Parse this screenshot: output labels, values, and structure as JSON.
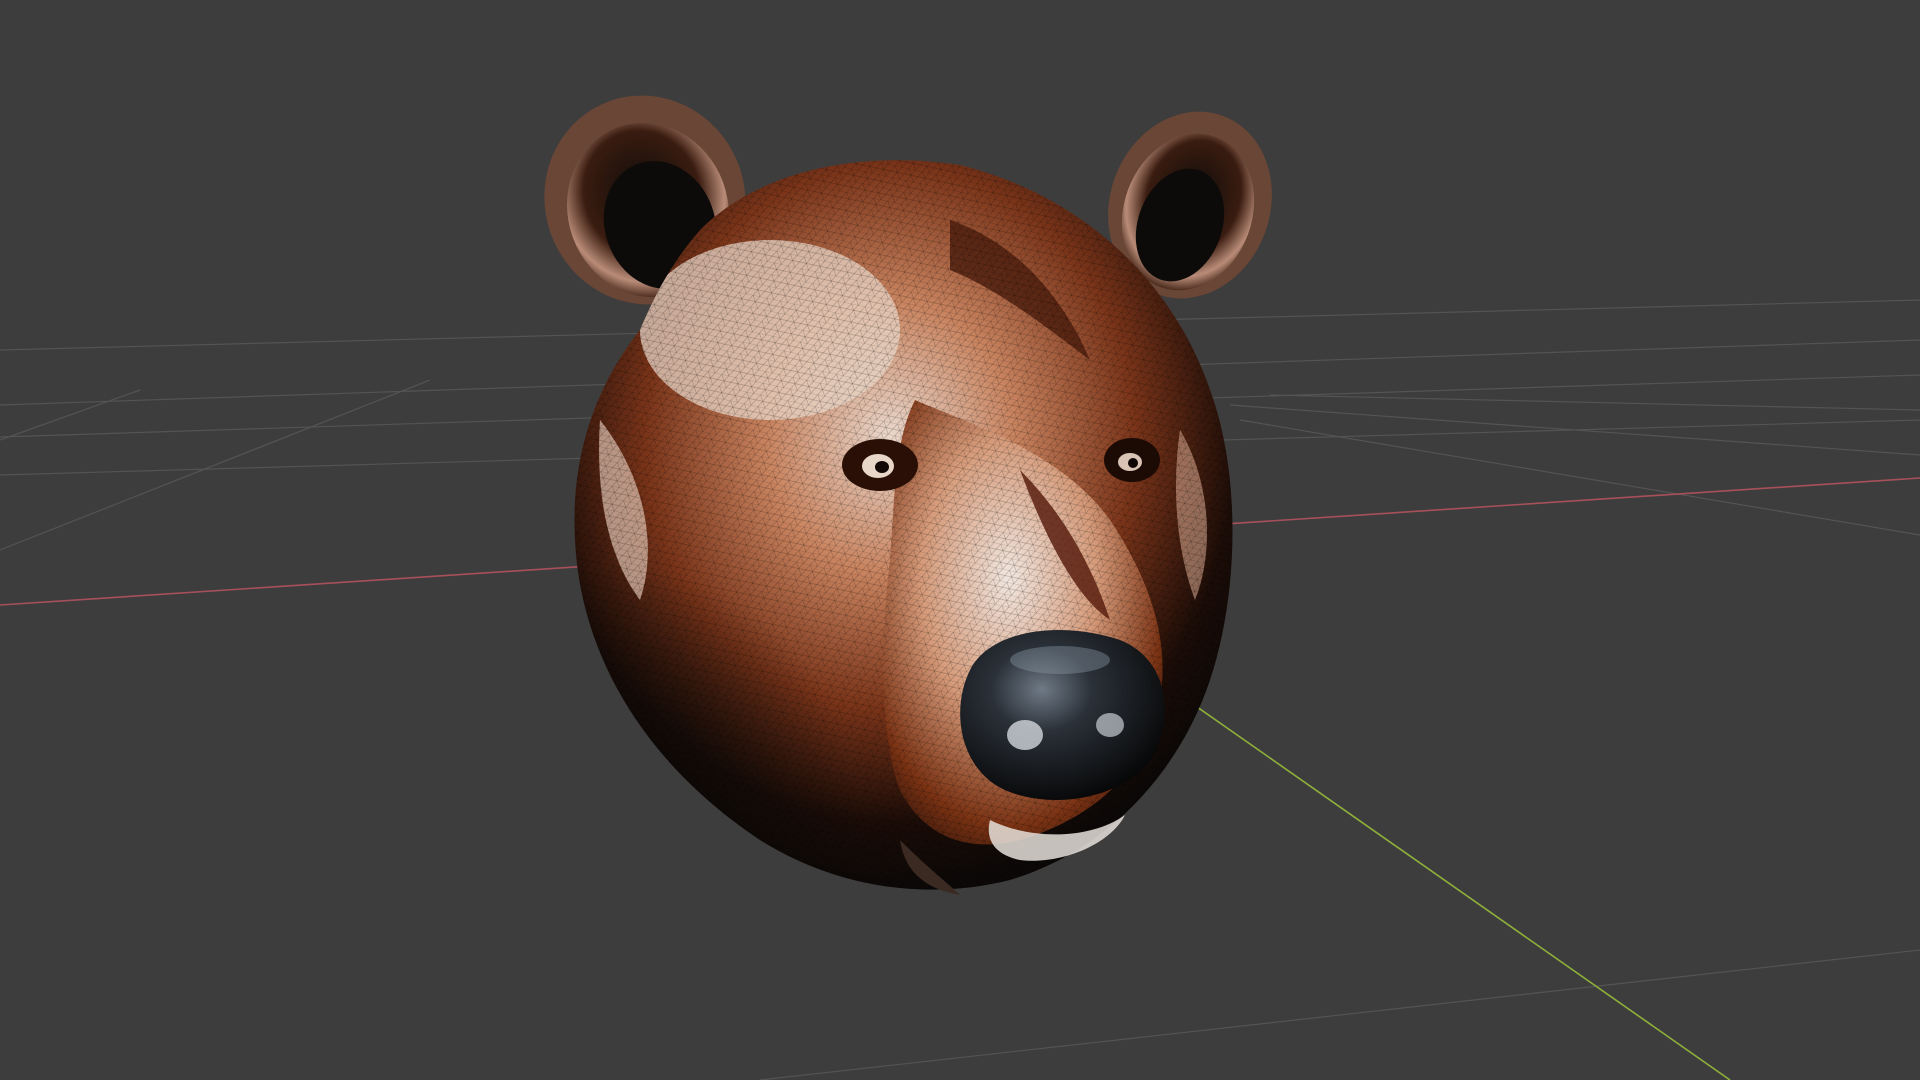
{
  "viewport": {
    "background": "#3d3d3d",
    "grid_color": "#545454",
    "x_axis_color": "#a8505a",
    "y_axis_color": "#8fb13a"
  },
  "object": {
    "subject": "bear-head-mesh",
    "fur_light": "#e9d8cf",
    "fur_mid": "#b8643a",
    "fur_dark": "#5a2412",
    "shadow": "#111111",
    "wireframe": "#000000"
  }
}
